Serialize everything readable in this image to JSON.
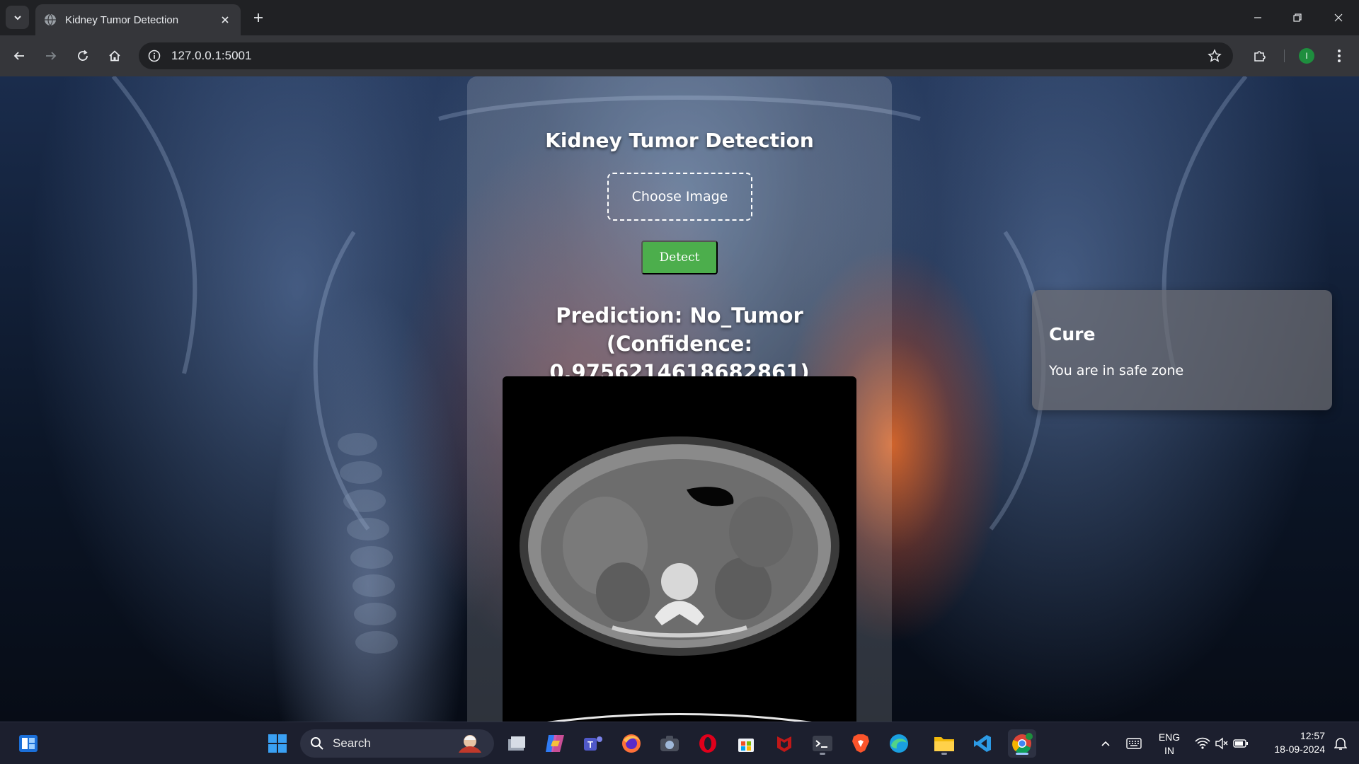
{
  "browser": {
    "tab_title": "Kidney Tumor Detection",
    "url": "127.0.0.1:5001",
    "profile_initial": "I"
  },
  "page": {
    "title": "Kidney Tumor Detection",
    "choose_label": "Choose Image",
    "detect_label": "Detect",
    "prediction_text": "Prediction: No_Tumor (Confidence: 0.9756214618682861)",
    "cure": {
      "heading": "Cure",
      "message": "You are in safe zone"
    }
  },
  "taskbar": {
    "search_label": "Search",
    "lang_line1": "ENG",
    "lang_line2": "IN",
    "time": "12:57",
    "date": "18-09-2024",
    "apps": [
      "file-explorer-icon",
      "copilot-icon",
      "teams-icon",
      "firefox-icon",
      "camera-icon",
      "opera-icon",
      "store-icon",
      "mcafee-icon",
      "terminal-icon",
      "brave-icon",
      "edge-icon",
      "folder-icon",
      "vscode-icon",
      "chrome-icon"
    ]
  },
  "colors": {
    "detect_button": "#4cae4c",
    "profile": "#1e8e3e",
    "tab_bar": "#202124",
    "toolbar": "#35363a"
  }
}
